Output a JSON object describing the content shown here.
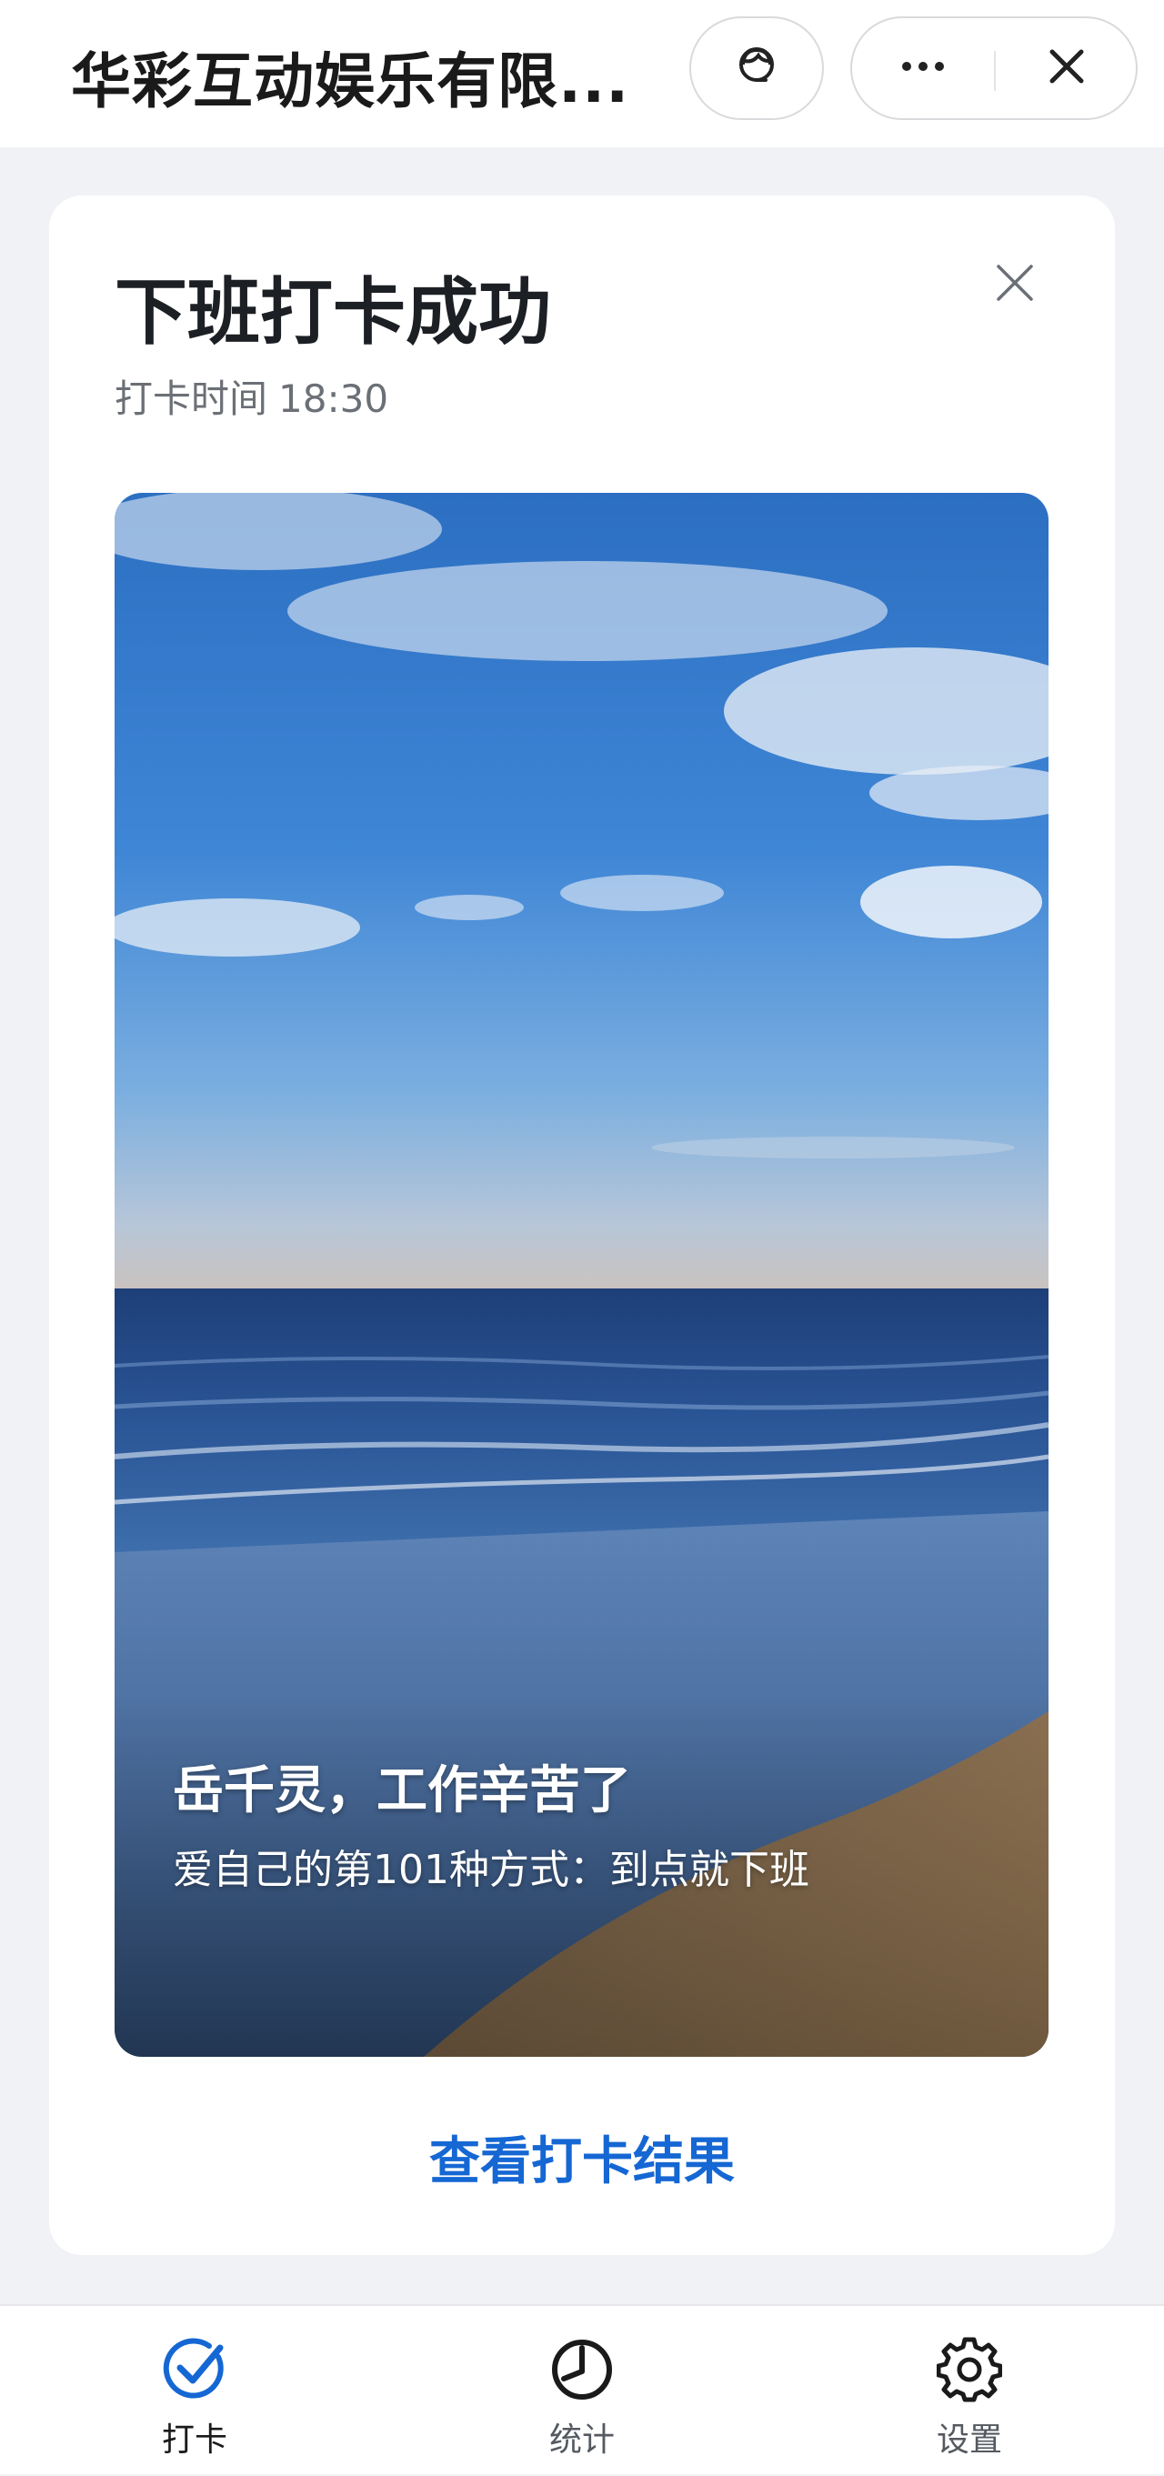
{
  "app": {
    "title": "华彩互动娱乐有限...",
    "service_icon": "customer-service-icon",
    "more_icon": "more-icon",
    "close_icon": "close-icon"
  },
  "card": {
    "title": "下班打卡成功",
    "close_icon": "close-icon",
    "punch_time_label": "打卡时间",
    "punch_time_value": "18:30",
    "greeting": "岳千灵，工作辛苦了",
    "subtitle": "爱自己的第101种方式：到点就下班",
    "view_result_link": "查看打卡结果"
  },
  "tabs": [
    {
      "label": "打卡",
      "icon": "check-icon",
      "active": true
    },
    {
      "label": "统计",
      "icon": "stats-icon",
      "active": false
    },
    {
      "label": "设置",
      "icon": "gear-icon",
      "active": false
    }
  ],
  "colors": {
    "accent": "#1567d3",
    "background": "#f1f2f5",
    "title_text": "#1c1f23",
    "secondary_text": "#6b6f76"
  }
}
